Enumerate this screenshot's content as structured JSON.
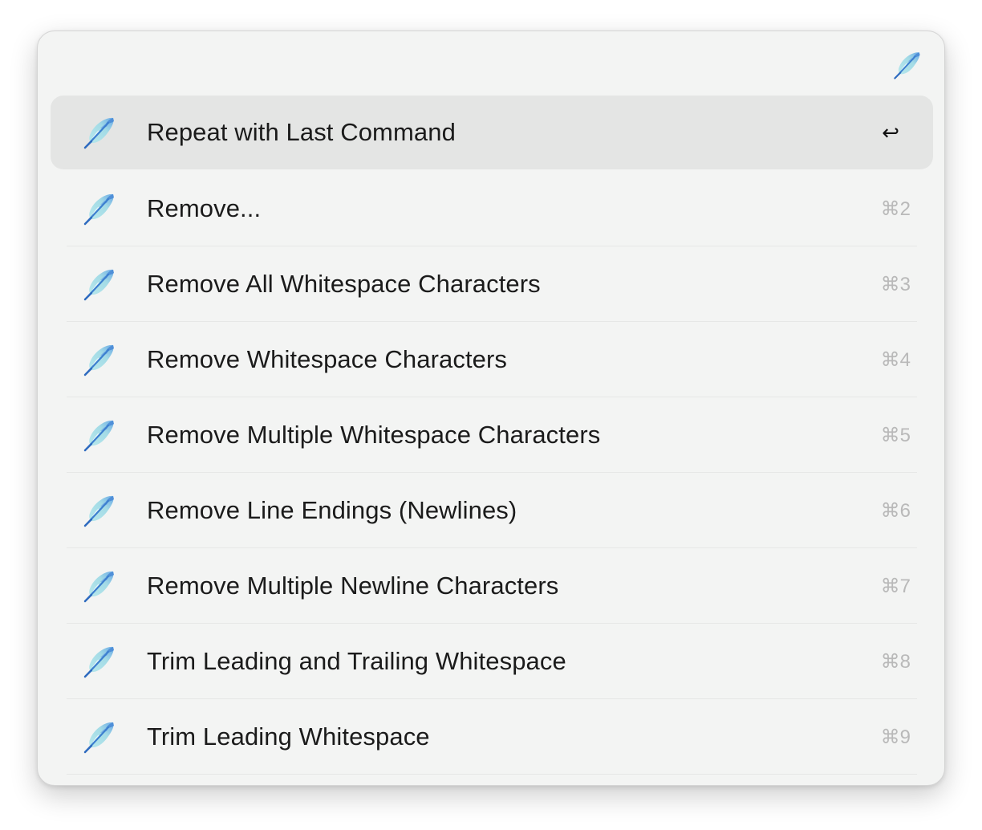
{
  "palette": {
    "panel_bg": "#f3f4f3",
    "selected_row_bg": "#e4e5e4",
    "text": "#1b1b1b",
    "shortcut_text": "#b9b9b9",
    "icon_feather_light": "#a6dfe6",
    "icon_feather_blue": "#5b9fe0"
  },
  "header": {
    "icon": "feather-icon"
  },
  "commands": [
    {
      "label": "Repeat with Last Command",
      "shortcut": "↩",
      "icon": "feather-icon",
      "selected": true
    },
    {
      "label": "Remove...",
      "shortcut": "⌘2",
      "icon": "feather-icon"
    },
    {
      "label": "Remove All Whitespace Characters",
      "shortcut": "⌘3",
      "icon": "feather-icon"
    },
    {
      "label": "Remove Whitespace Characters",
      "shortcut": "⌘4",
      "icon": "feather-icon"
    },
    {
      "label": "Remove Multiple Whitespace Characters",
      "shortcut": "⌘5",
      "icon": "feather-icon"
    },
    {
      "label": "Remove Line Endings (Newlines)",
      "shortcut": "⌘6",
      "icon": "feather-icon"
    },
    {
      "label": "Remove Multiple Newline Characters",
      "shortcut": "⌘7",
      "icon": "feather-icon"
    },
    {
      "label": "Trim Leading and Trailing Whitespace",
      "shortcut": "⌘8",
      "icon": "feather-icon"
    },
    {
      "label": "Trim Leading Whitespace",
      "shortcut": "⌘9",
      "icon": "feather-icon"
    }
  ]
}
